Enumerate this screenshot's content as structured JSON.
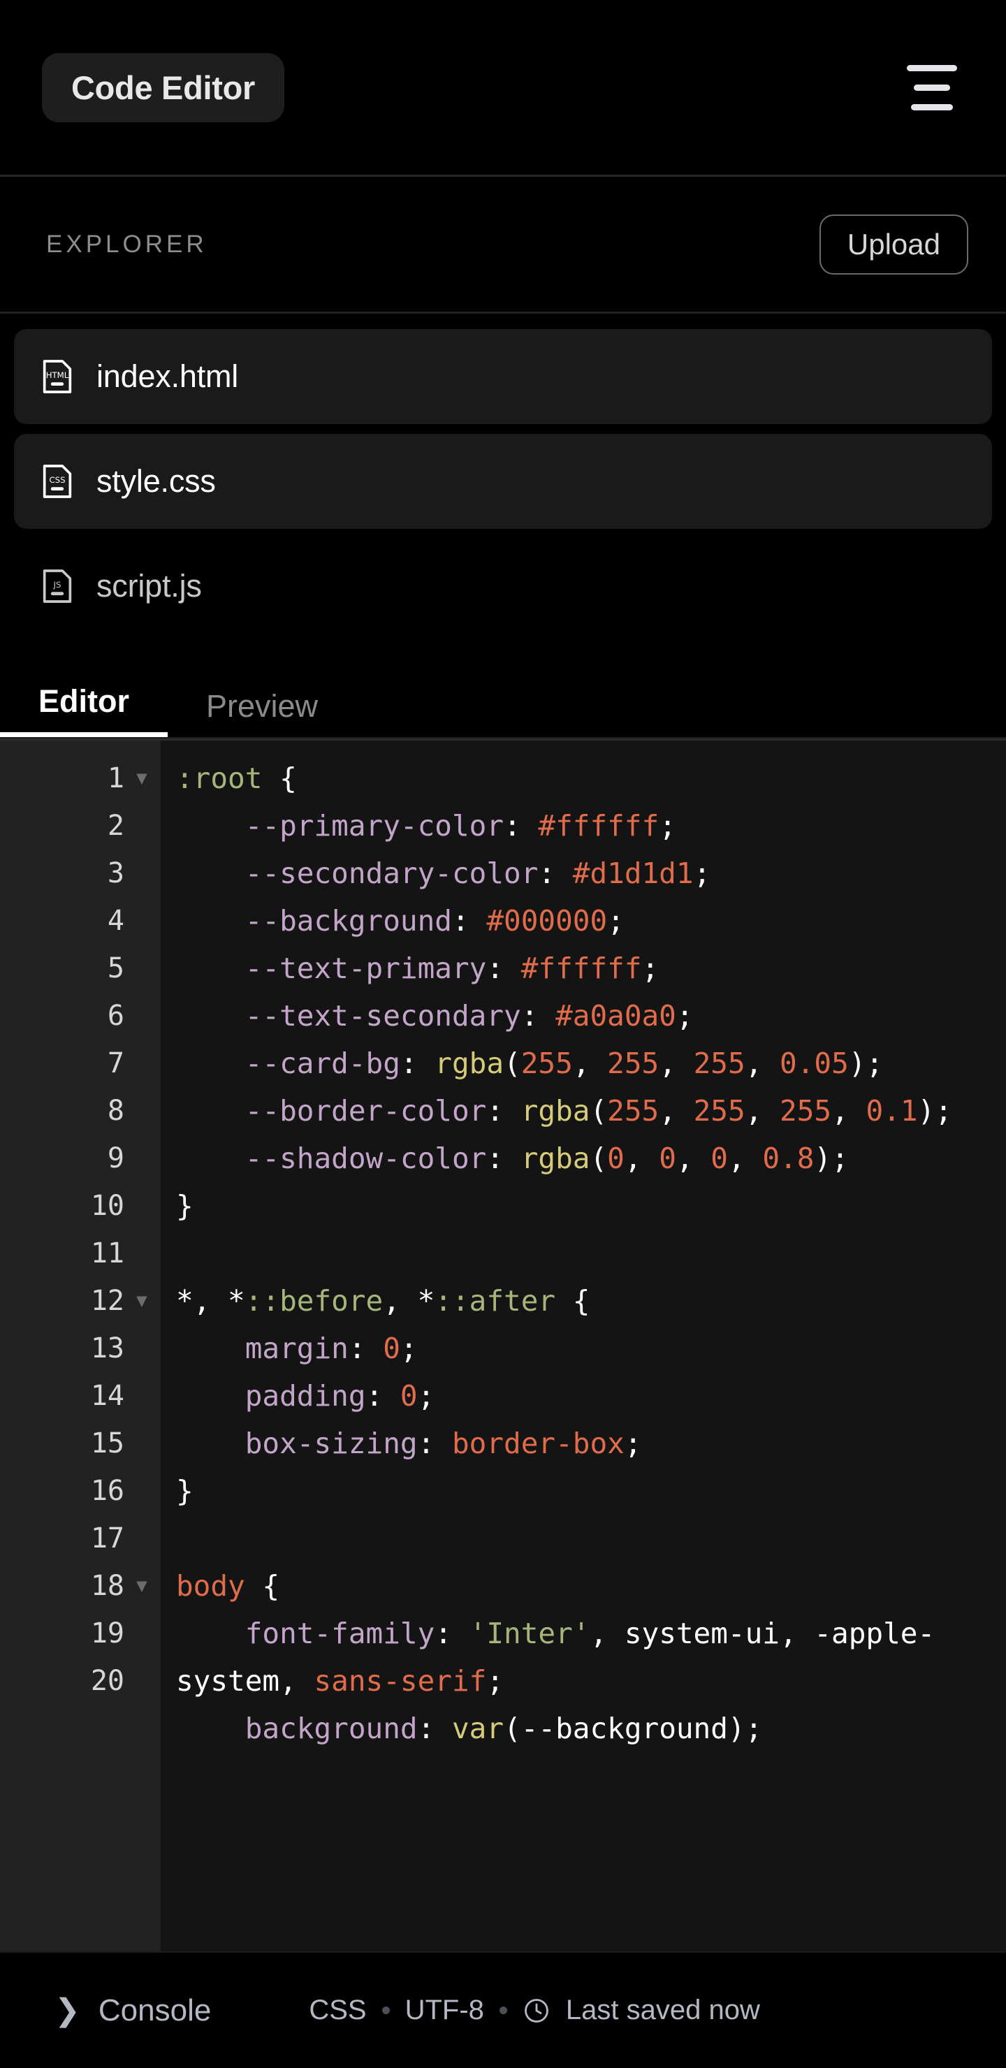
{
  "header": {
    "title": "Code Editor",
    "menu_icon": "hamburger-icon"
  },
  "explorer": {
    "label": "EXPLORER",
    "upload_label": "Upload",
    "files": [
      {
        "name": "index.html",
        "type": "HTML",
        "icon": "html-file-icon",
        "active": true
      },
      {
        "name": "style.css",
        "type": "CSS",
        "icon": "css-file-icon",
        "active": true
      },
      {
        "name": "script.js",
        "type": "JS",
        "icon": "js-file-icon",
        "active": false
      }
    ]
  },
  "tabs": [
    {
      "label": "Editor",
      "active": true
    },
    {
      "label": "Preview",
      "active": false
    }
  ],
  "editor": {
    "lines": [
      {
        "n": "1",
        "fold": true
      },
      {
        "n": "2",
        "fold": false
      },
      {
        "n": "3",
        "fold": false
      },
      {
        "n": "4",
        "fold": false
      },
      {
        "n": "5",
        "fold": false
      },
      {
        "n": "6",
        "fold": false
      },
      {
        "n": "7",
        "fold": false
      },
      {
        "n": "8",
        "fold": false
      },
      {
        "n": "9",
        "fold": false
      },
      {
        "n": "10",
        "fold": false
      },
      {
        "n": "11",
        "fold": false
      },
      {
        "n": "12",
        "fold": true
      },
      {
        "n": "13",
        "fold": false
      },
      {
        "n": "14",
        "fold": false
      },
      {
        "n": "15",
        "fold": false
      },
      {
        "n": "16",
        "fold": false
      },
      {
        "n": "17",
        "fold": false
      },
      {
        "n": "18",
        "fold": true
      },
      {
        "n": "19",
        "fold": false
      },
      {
        "n": "20",
        "fold": false
      }
    ],
    "code_lines": [
      ":root {",
      "    --primary-color: #ffffff;",
      "    --secondary-color: #d1d1d1;",
      "    --background: #000000;",
      "    --text-primary: #ffffff;",
      "    --text-secondary: #a0a0a0;",
      "    --card-bg: rgba(255, 255, 255, 0.05);",
      "    --border-color: rgba(255, 255, 255, 0.1);",
      "    --shadow-color: rgba(0, 0, 0, 0.8);",
      "}",
      "",
      "*, *::before, *::after {",
      "    margin: 0;",
      "    padding: 0;",
      "    box-sizing: border-box;",
      "}",
      "",
      "body {",
      "    font-family: 'Inter', system-ui, -apple-system, sans-serif;",
      "    background: var(--background);"
    ],
    "language": "CSS"
  },
  "statusbar": {
    "console_label": "Console",
    "console_chevron": "chevron-right-icon",
    "language": "CSS",
    "encoding": "UTF-8",
    "saved_text": "Last saved now",
    "clock_icon": "clock-icon"
  },
  "colors": {
    "background": "#000000",
    "code_bg": "#141414",
    "gutter_bg": "#222222",
    "chip_bg": "#1e1e1e",
    "row_active_bg": "#1a1a1a",
    "accent_selector": "#a6b67a",
    "accent_value": "#e06c4b",
    "accent_property": "#c3a5c9",
    "accent_function": "#d6cb79",
    "text_muted": "#8d8d8d"
  }
}
